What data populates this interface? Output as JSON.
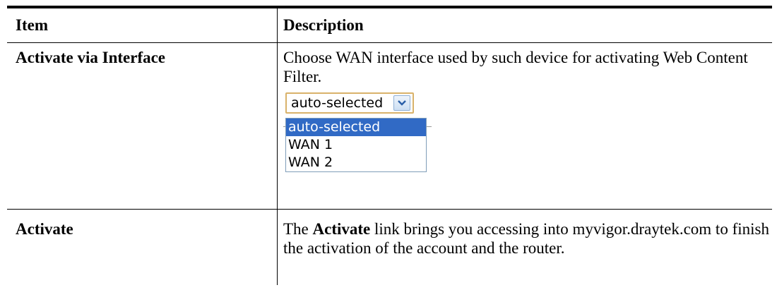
{
  "table": {
    "header": {
      "item": "Item",
      "description": "Description"
    },
    "rows": [
      {
        "item": "Activate via Interface",
        "description": "Choose WAN interface used by such device for activating Web Content Filter.",
        "widget": {
          "selected_value": "auto-selected",
          "options": [
            "auto-selected",
            "WAN 1",
            "WAN 2"
          ]
        }
      },
      {
        "item": "Activate",
        "desc_prefix": "The ",
        "desc_bold": "Activate",
        "desc_suffix": " link brings you accessing into myvigor.draytek.com to finish the activation of the account and the router."
      }
    ]
  }
}
